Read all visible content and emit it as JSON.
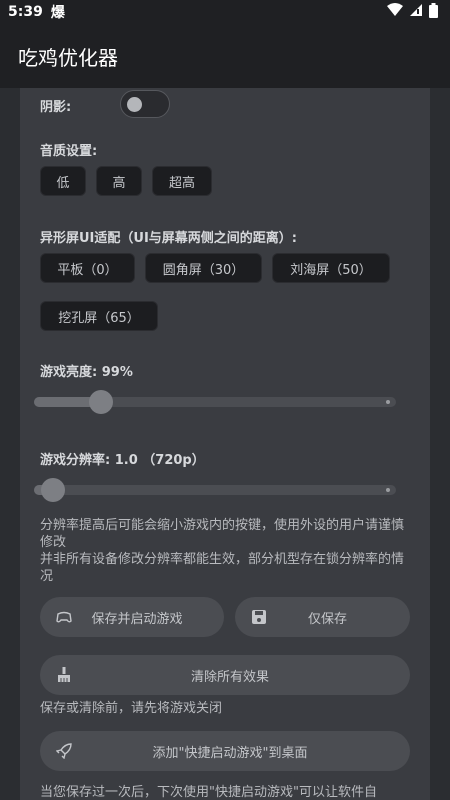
{
  "status_bar": {
    "time": "5:39",
    "notif_glyph": "爆",
    "icons": [
      "wifi-icon",
      "signal-icon",
      "battery-icon"
    ]
  },
  "app_bar": {
    "title": "吃鸡优化器"
  },
  "shadow": {
    "label": "阴影:",
    "enabled": false
  },
  "audio": {
    "label": "音质设置:",
    "options": [
      "低",
      "高",
      "超高"
    ]
  },
  "notch": {
    "label": "异形屏UI适配（UI与屏幕两侧之间的距离）:",
    "options": [
      "平板（0）",
      "圆角屏（30）",
      "刘海屏（50）",
      "挖孔屏（65）"
    ]
  },
  "brightness": {
    "label": "游戏亮度: 99%",
    "value": 0.99
  },
  "resolution": {
    "label": "游戏分辨率: 1.0 （720p）",
    "value": 0.1
  },
  "note": {
    "line1": "分辨率提高后可能会缩小游戏内的按键，使用外设的用户请谨慎修改",
    "line2": "并非所有设备修改分辨率都能生效，部分机型存在锁分辨率的情况"
  },
  "buttons": {
    "save_launch": "保存并启动游戏",
    "save_only": "仅保存",
    "clear_all": "清除所有效果",
    "add_shortcut": "添加\"快捷启动游戏\"到桌面"
  },
  "hint": "保存或清除前，请先将游戏关闭",
  "footer_partial": "当您保存过一次后，下次使用\"快捷启动游戏\"可以让软件自",
  "colors": {
    "background": "#2b2d31",
    "card": "#3a3c41",
    "chip": "#1c1d20",
    "button": "#4b4d52"
  }
}
